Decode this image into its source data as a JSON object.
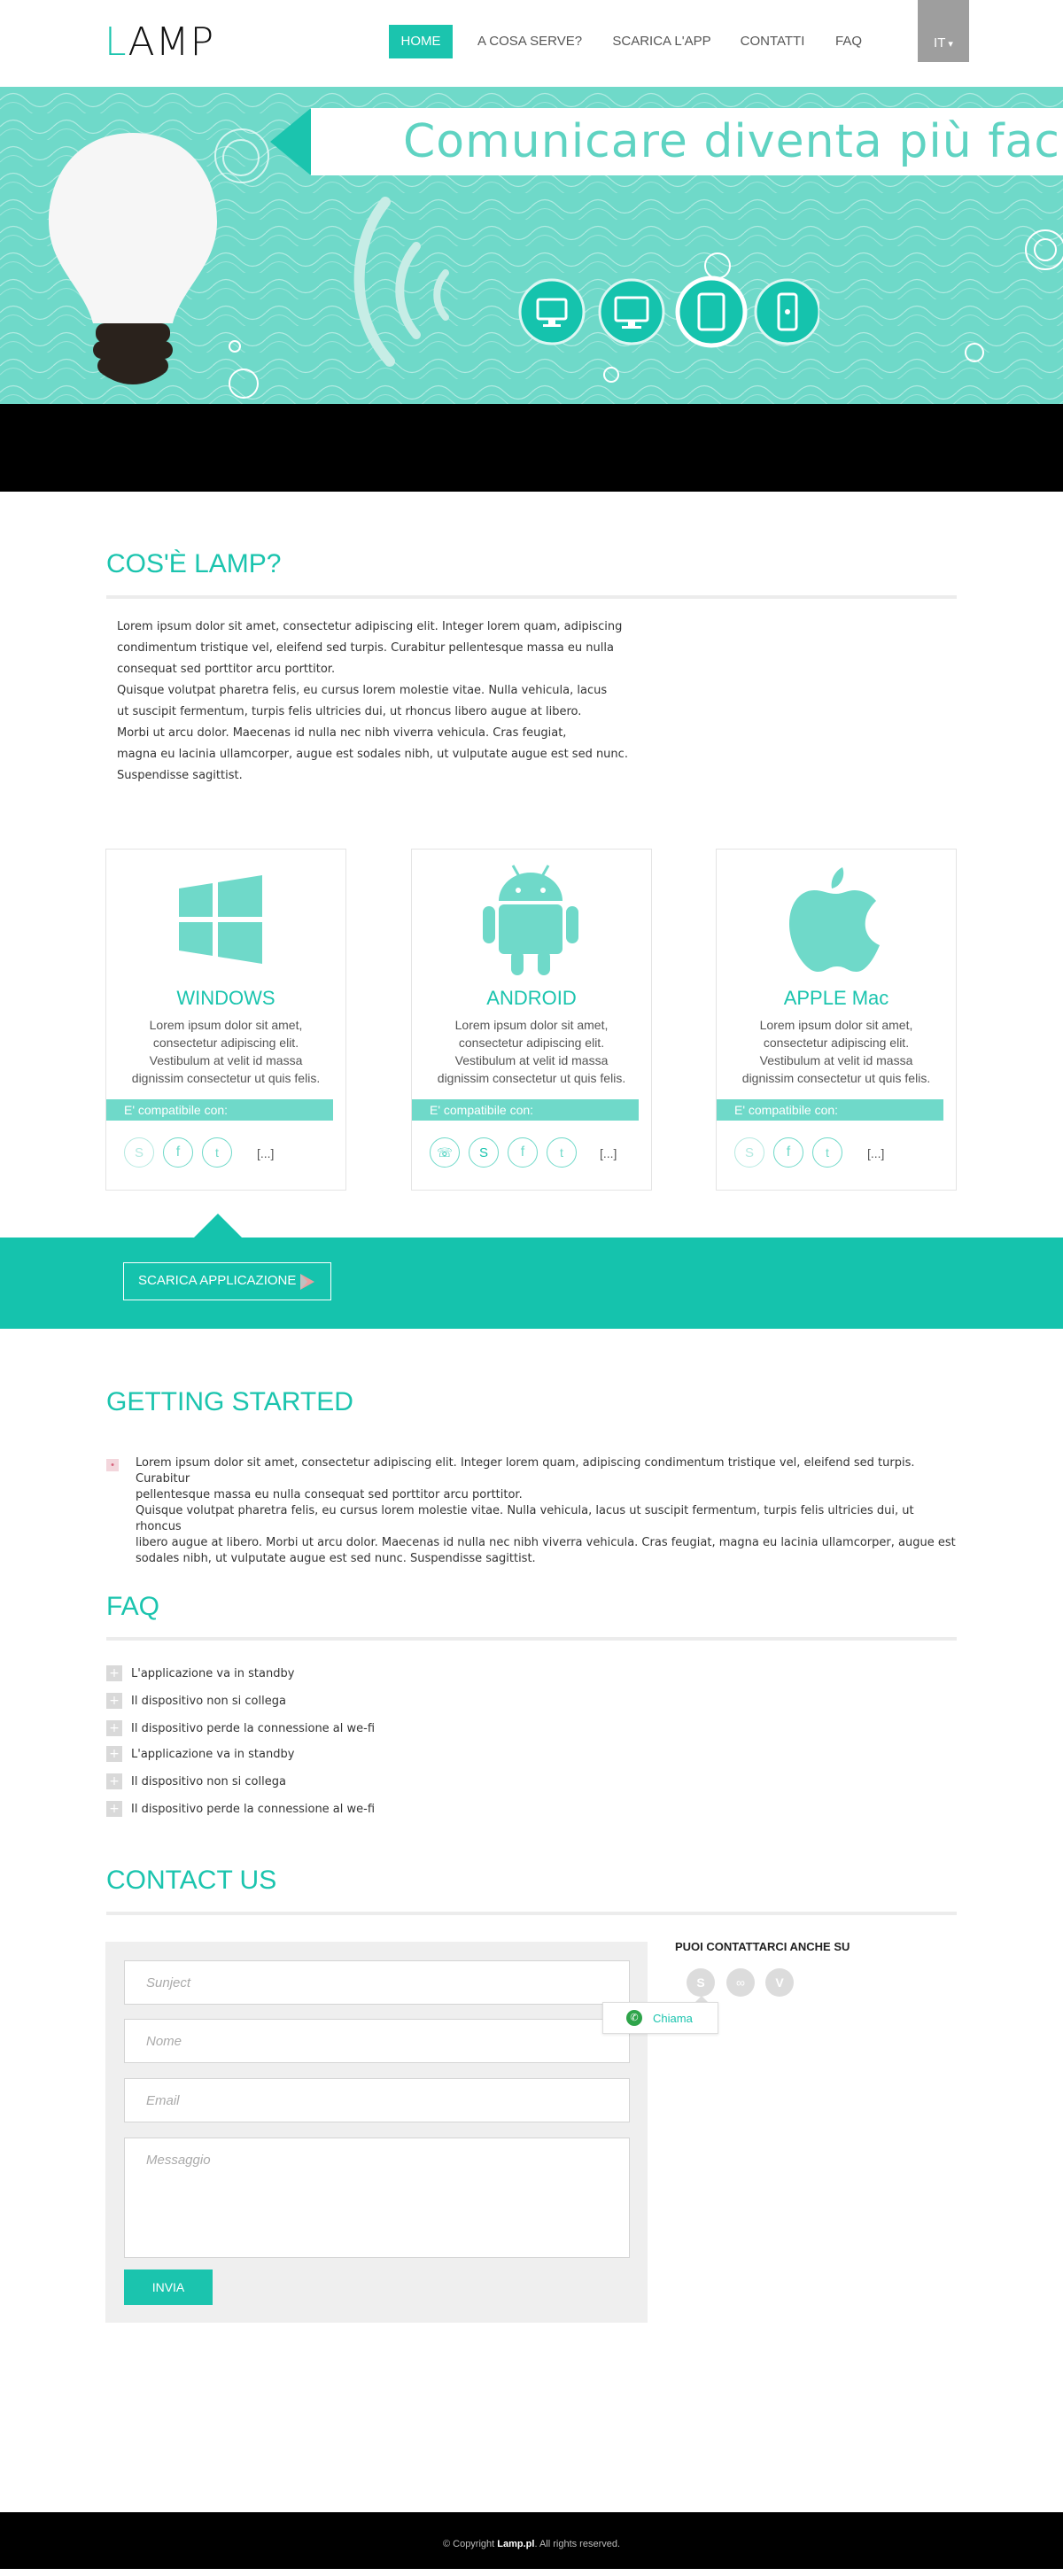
{
  "brand": {
    "logo_first": "L",
    "logo_rest": "AMP"
  },
  "nav": {
    "home": "HOME",
    "about": "A COSA SERVE?",
    "download": "SCARICA L'APP",
    "contacts": "CONTATTI",
    "faq": "FAQ",
    "lang": "IT"
  },
  "hero": {
    "title": "Comunicare diventa più facile"
  },
  "about": {
    "heading": "COS'È LAMP?",
    "lines": [
      "Lorem ipsum dolor sit amet, consectetur adipiscing elit. Integer lorem quam, adipiscing",
      "condimentum tristique vel, eleifend sed turpis. Curabitur  pellentesque massa eu nulla",
      "consequat sed porttitor arcu porttitor.",
      "Quisque volutpat pharetra felis, eu cursus lorem molestie vitae. Nulla vehicula, lacus",
      "ut suscipit fermentum, turpis felis ultricies dui, ut rhoncus libero augue at libero.",
      "Morbi ut arcu dolor. Maecenas id nulla nec nibh viverra vehicula. Cras feugiat,",
      "magna eu lacinia ullamcorper, augue est sodales nibh, ut vulputate augue est sed nunc.",
      "Suspendisse sagittist."
    ]
  },
  "platforms": [
    {
      "title": "WINDOWS",
      "text": [
        "Lorem ipsum dolor sit amet,",
        "consectetur adipiscing elit.",
        "Vestibulum at velit id massa",
        "dignissim consectetur ut quis felis."
      ],
      "compat": "E' compatibile con:",
      "more": "[...]"
    },
    {
      "title": "ANDROID",
      "text": [
        "Lorem ipsum dolor sit amet,",
        "consectetur adipiscing elit.",
        "Vestibulum at velit id massa",
        "dignissim consectetur ut quis felis."
      ],
      "compat": "E' compatibile con:",
      "more": "[...]"
    },
    {
      "title": "APPLE Mac",
      "text": [
        "Lorem ipsum dolor sit amet,",
        "consectetur adipiscing elit.",
        "Vestibulum at velit id massa",
        "dignissim consectetur ut quis felis."
      ],
      "compat": "E' compatibile con:",
      "more": "[...]"
    }
  ],
  "download_button": "SCARICA APPLICAZIONE",
  "getting_started": {
    "heading": "GETTING STARTED",
    "lines": [
      "Lorem ipsum dolor sit amet, consectetur adipiscing elit. Integer lorem quam, adipiscing condimentum tristique vel, eleifend sed turpis. Curabitur",
      "pellentesque massa eu nulla consequat sed porttitor arcu porttitor.",
      "Quisque volutpat pharetra felis, eu cursus lorem molestie vitae. Nulla vehicula, lacus ut suscipit fermentum, turpis felis ultricies dui, ut rhoncus",
      "libero augue at libero. Morbi ut arcu dolor. Maecenas id nulla nec nibh viverra vehicula. Cras feugiat, magna eu lacinia ullamcorper, augue est",
      "sodales nibh, ut vulputate augue est sed nunc. Suspendisse sagittist."
    ]
  },
  "faq": {
    "heading": "FAQ",
    "items": [
      "L'applicazione va in standby",
      "Il dispositivo non si collega",
      "Il dispositivo perde la connessione al we-fi",
      "L'applicazione va in standby",
      "Il dispositivo non si collega",
      "Il dispositivo perde la connessione al we-fi"
    ]
  },
  "contact": {
    "heading": "CONTACT US",
    "subject_placeholder": "Sunject",
    "name_placeholder": "Nome",
    "email_placeholder": "Email",
    "message_placeholder": "Messaggio",
    "send": "INVIA",
    "also_heading": "PUOI CONTATTARCI ANCHE SU",
    "call": "Chiama"
  },
  "footer": {
    "prefix": "© Copyright ",
    "brand": "Lamp.pl",
    "suffix": ". All rights reserved."
  },
  "colors": {
    "accent": "#1bc4ae",
    "accent_light": "#6fd9c9",
    "footer": "#000000"
  }
}
